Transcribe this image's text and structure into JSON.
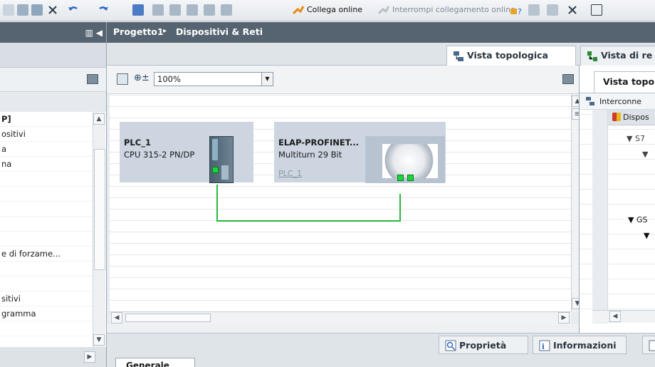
{
  "toolbar": {
    "connect_online_label": "Collega online",
    "disconnect_online_label": "Interrompi collegamento online"
  },
  "breadcrumb": {
    "project": "Progetto1",
    "separator": "▸",
    "page": "Dispositivi & Reti"
  },
  "view_tabs": [
    {
      "label": "Vista topologica",
      "active": true
    },
    {
      "label": "Vista di re",
      "active": false
    }
  ],
  "canvas_toolbar": {
    "zoom_value": "100%"
  },
  "left_list": [
    "P]",
    "ositivi",
    "a",
    "na",
    "",
    "",
    "",
    "",
    "",
    "e di forzame...",
    "",
    "",
    "sitivi",
    "gramma",
    ""
  ],
  "devices": {
    "plc": {
      "name": "PLC_1",
      "type": "CPU 315-2 PN/DP"
    },
    "elap": {
      "name": "ELAP-PROFINET...",
      "type": "Multiturn 29 Bit",
      "link": "PLC_1"
    }
  },
  "right_pane": {
    "tab_label": "Vista topo",
    "interconnect_label": "Interconne",
    "column_header": "Dispos",
    "tree_items": [
      "S7",
      "",
      "GS",
      ""
    ]
  },
  "inspector": {
    "tabs": [
      {
        "label": "Proprietà"
      },
      {
        "label": "Informazioni"
      }
    ],
    "general_tab": "Generale"
  },
  "colors": {
    "header_bar": "#566471",
    "profinet_link": "#2ab73a",
    "device_card": "#cdd5e0",
    "port_active": "#19d53a"
  }
}
